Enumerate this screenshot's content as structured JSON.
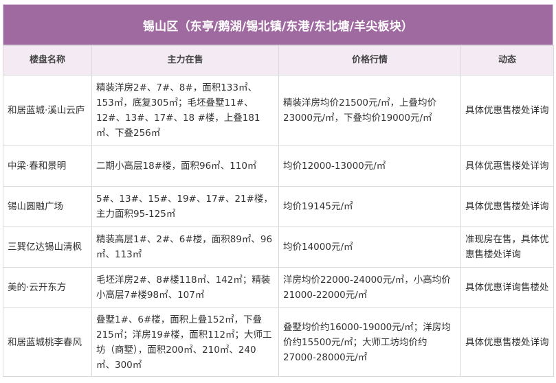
{
  "title": "锡山区（东亭/鹅湖/锡北镇/东港/东北塘/羊尖板块）",
  "columns": [
    "楼盘名称",
    "主力在售",
    "价格行情",
    "动态"
  ],
  "rows": [
    {
      "name": "和居蓝城·溪山云庐",
      "main": "精装洋房2#、7#、8#，面积133㎡、153㎡，底复305㎡；毛坯叠墅11#、12#、13#、17#、18 #楼，上叠181㎡、下叠256㎡",
      "price": "精装洋房均价21500元/㎡，上叠均价23000元/㎡，下叠均价19000元/㎡",
      "status": "具体优惠售楼处详询"
    },
    {
      "name": "中梁·春和景明",
      "main": "二期小高层18#楼，面积96㎡、110㎡",
      "price": "均价12000-13000元/㎡",
      "status": "具体优惠售楼处详询"
    },
    {
      "name": "锡山圆融广场",
      "main": "5#、13#、15#、19#、17#、21#楼，主力面积95-125㎡",
      "price": "均价19145元/㎡",
      "status": "具体优惠售楼处详询"
    },
    {
      "name": "三巽亿达锡山清枫",
      "main": "精装高层1#、2#、6#楼，面积89㎡、96㎡、113㎡",
      "price": "均价14000元/㎡",
      "status": "准现房在售，具体优惠售楼处详询"
    },
    {
      "name": "美的·云开东方",
      "main": "毛坯洋房2#、8#楼118㎡、142㎡；精装小高层7#楼98㎡、107㎡",
      "price": "洋房均价22000-24000元/㎡，小高均价21000-22000元/㎡",
      "status": "具体优惠详询售楼处"
    },
    {
      "name": "和居蓝城桃李春风",
      "main": "叠墅1#、6#楼，面积上叠152㎡，下叠215㎡；洋房19#楼，面积112㎡；大师工坊（商墅），面积200㎡、210㎡、240㎡、300㎡",
      "price": "叠墅均价约16000-19000元/㎡；洋房均价约15500元/㎡；大师工坊均价约27000-28000元/㎡",
      "status": "具体优惠售楼处详询"
    }
  ]
}
